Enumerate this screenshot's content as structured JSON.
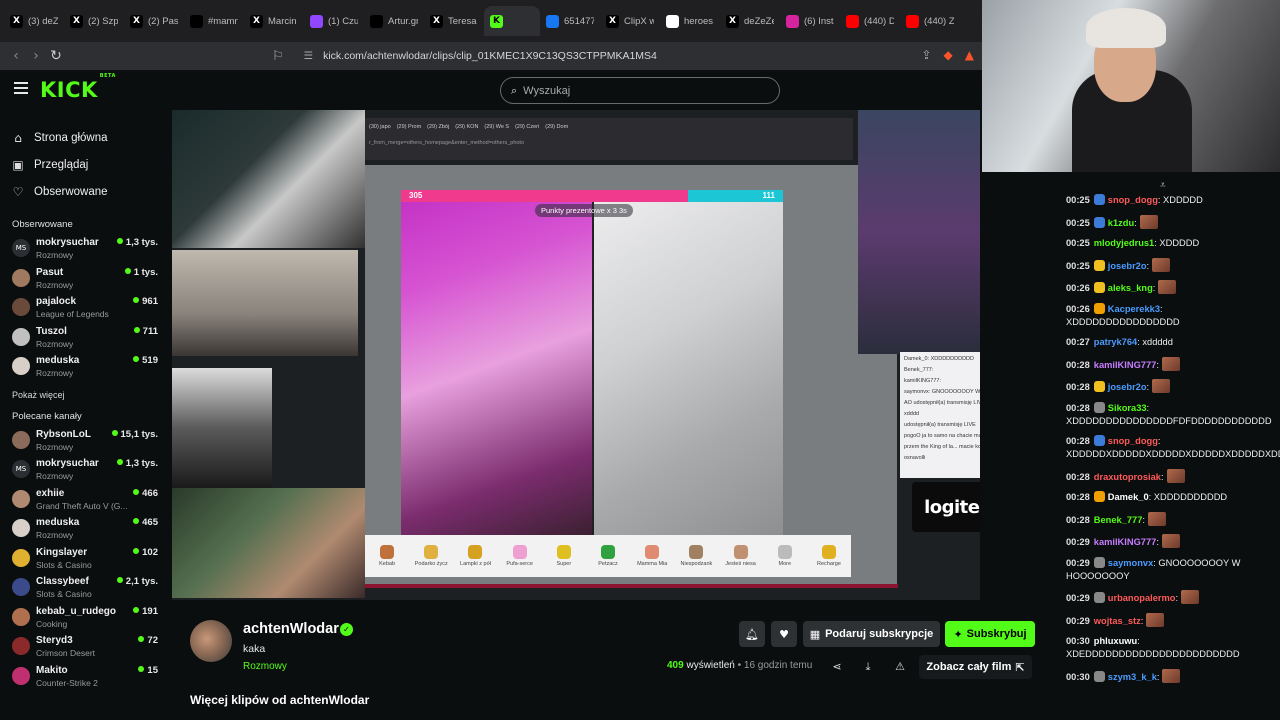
{
  "browser": {
    "tabs": [
      {
        "label": "(3) deZe",
        "icon": "x-icon",
        "color": "#000000"
      },
      {
        "label": "(2) Szpy",
        "icon": "x-icon",
        "color": "#000000"
      },
      {
        "label": "(2) Pasu",
        "icon": "x-icon",
        "color": "#000000"
      },
      {
        "label": "#mamn",
        "icon": "tiktok-icon",
        "color": "#000000"
      },
      {
        "label": "Marcin",
        "icon": "x-icon",
        "color": "#000000"
      },
      {
        "label": "(1) Czuj",
        "icon": "twitch-icon",
        "color": "#9146ff"
      },
      {
        "label": "Artur.gr",
        "icon": "tiktok-icon",
        "color": "#000000"
      },
      {
        "label": "Teresa",
        "icon": "x-icon",
        "color": "#000000"
      },
      {
        "label": "",
        "icon": "kick-icon",
        "color": "#53fc18",
        "active": true
      },
      {
        "label": "651477",
        "icon": "facebook-icon",
        "color": "#1877f2"
      },
      {
        "label": "ClipX w",
        "icon": "x-icon",
        "color": "#000000"
      },
      {
        "label": "heroes",
        "icon": "google-icon",
        "color": "#ffffff"
      },
      {
        "label": "deZeZe",
        "icon": "x-icon",
        "color": "#000000"
      },
      {
        "label": "(6) Insta",
        "icon": "instagram-icon",
        "color": "#d6249f"
      },
      {
        "label": "(440) D",
        "icon": "youtube-icon",
        "color": "#ff0000"
      },
      {
        "label": "(440) Z",
        "icon": "youtube-icon",
        "color": "#ff0000"
      }
    ],
    "url": "kick.com/achtenwlodar/clips/clip_01KMEC1X9C13QS3CTPPMKA1MS4"
  },
  "header": {
    "logo": "KICK",
    "logo_badge": "BETA",
    "search_placeholder": "Wyszukaj"
  },
  "sidebar": {
    "nav": [
      {
        "label": "Strona główna",
        "icon": "home-icon"
      },
      {
        "label": "Przeglądaj",
        "icon": "browse-icon"
      },
      {
        "label": "Obserwowane",
        "icon": "heart-icon"
      }
    ],
    "followed_heading": "Obserwowane",
    "followed": [
      {
        "name": "mokrysuchar",
        "category": "Rozmowy",
        "viewers": "1,3 tys.",
        "avatar": "MS",
        "color": "#2b2f33"
      },
      {
        "name": "Pasut",
        "category": "Rozmowy",
        "viewers": "1 tys.",
        "avatar": "",
        "color": "#a07a60"
      },
      {
        "name": "pajalock",
        "category": "League of Legends",
        "viewers": "961",
        "avatar": "",
        "color": "#6a4a3a"
      },
      {
        "name": "Tuszol",
        "category": "Rozmowy",
        "viewers": "711",
        "avatar": "",
        "color": "#c0c0c0"
      },
      {
        "name": "meduska",
        "category": "Rozmowy",
        "viewers": "519",
        "avatar": "",
        "color": "#d8d0c8"
      }
    ],
    "show_more": "Pokaż więcej",
    "recommended_heading": "Polecane kanały",
    "recommended": [
      {
        "name": "RybsonLoL",
        "category": "Rozmowy",
        "viewers": "15,1 tys.",
        "avatar": "",
        "color": "#8a6b5a"
      },
      {
        "name": "mokrysuchar",
        "category": "Rozmowy",
        "viewers": "1,3 tys.",
        "avatar": "MS",
        "color": "#2b2f33"
      },
      {
        "name": "exhiie",
        "category": "Grand Theft Auto V (G...",
        "viewers": "466",
        "avatar": "",
        "color": "#b08a70"
      },
      {
        "name": "meduska",
        "category": "Rozmowy",
        "viewers": "465",
        "avatar": "",
        "color": "#d8d0c8"
      },
      {
        "name": "Kingslayer",
        "category": "Slots & Casino",
        "viewers": "102",
        "avatar": "",
        "color": "#e0b030"
      },
      {
        "name": "Classybeef",
        "category": "Slots & Casino",
        "viewers": "2,1 tys.",
        "avatar": "",
        "color": "#3a4a8a"
      },
      {
        "name": "kebab_u_rudego",
        "category": "Cooking",
        "viewers": "191",
        "avatar": "",
        "color": "#b07050"
      },
      {
        "name": "Steryd3",
        "category": "Crimson Desert",
        "viewers": "72",
        "avatar": "",
        "color": "#8a2a2a"
      },
      {
        "name": "Makito",
        "category": "Counter-Strike 2",
        "viewers": "15",
        "avatar": "",
        "color": "#c03070"
      }
    ]
  },
  "video": {
    "pip_tabs": [
      "(30) japo",
      "(29) Prom",
      "(29) Zbój",
      "(29) KON",
      "(29) We S",
      "(29) Czeri",
      "(29) Dom"
    ],
    "pip_url": "r_from_merge=others_homepage&enter_method=others_photo",
    "score_left": "305",
    "score_right": "111",
    "score_fraction": 0.75,
    "battle_pill": "Punkty prezentowe x 3   3s",
    "gifts": [
      "Kebab",
      "Podarko życz",
      "Lampki z pół",
      "Pufa-serce",
      "Super",
      "Petzacz",
      "Mamma Mia",
      "Niespodzank",
      "Jesteś niesa",
      "More",
      "Recharge"
    ],
    "logitech": "logitech",
    "inner_chat": [
      "Damek_0: XDDDDDDDDDD",
      "Benek_777:",
      "kamilKING777:",
      "saymonvx: GNOOOOOOOY W HOOOOOOOY",
      "AO  udostępnił(a) transmisję LIVE",
      "xdddd",
      "udostępnił(a) transmisję LIVE",
      "pogoO  ja to samo na chacie mam",
      "przem the King of la... macie kontakt z matem palmerem",
      "osnavolli"
    ]
  },
  "chat": {
    "messages": [
      {
        "time": "00:25",
        "user": "snop_dogg",
        "text": ": XDDDDD",
        "color": "#ff5a5a",
        "badge": "#3d7bd9",
        "emote": false
      },
      {
        "time": "00:25",
        "user": "k1zdu",
        "text": ":",
        "color": "#53fc18",
        "badge": "#3d7bd9",
        "emote": true
      },
      {
        "time": "00:25",
        "user": "mlodyjedrus1",
        "text": ": XDDDDD",
        "color": "#53fc18",
        "badge": "",
        "emote": false
      },
      {
        "time": "00:25",
        "user": "josebr2o",
        "text": ":",
        "color": "#4a9cff",
        "badge": "#f0c020",
        "emote": true
      },
      {
        "time": "00:26",
        "user": "aleks_kng",
        "text": ":",
        "color": "#53fc18",
        "badge": "#f0c020",
        "emote": true
      },
      {
        "time": "00:26",
        "user": "Kacperekk3",
        "text": ": XDDDDDDDDDDDDDDDD",
        "color": "#4a9cff",
        "badge": "#f0a000",
        "emote": false
      },
      {
        "time": "00:27",
        "user": "patryk764",
        "text": ": xddddd",
        "color": "#4a9cff",
        "badge": "",
        "emote": false
      },
      {
        "time": "00:28",
        "user": "kamilKING777",
        "text": ":",
        "color": "#c77dff",
        "badge": "",
        "emote": true
      },
      {
        "time": "00:28",
        "user": "josebr2o",
        "text": ":",
        "color": "#4a9cff",
        "badge": "#f0c020",
        "emote": true
      },
      {
        "time": "00:28",
        "user": "Sikora33",
        "text": ": XDDDDDDDDDDDDDDDFDFDDDDDDDDDDDD",
        "color": "#53fc18",
        "badge": "#888888",
        "emote": false
      },
      {
        "time": "00:28",
        "user": "snop_dogg",
        "text": ": XDDDDDXDDDDDXDDDDDXDDDDDXDDDDDXDDDDDXDDDDDV",
        "color": "#ff5a5a",
        "badge": "#3d7bd9",
        "emote": false
      },
      {
        "time": "00:28",
        "user": "draxutoprosiak",
        "text": ":",
        "color": "#ff5a5a",
        "badge": "",
        "emote": true
      },
      {
        "time": "00:28",
        "user": "Damek_0",
        "text": ": XDDDDDDDDDD",
        "color": "#ffffff",
        "badge": "#f0a000",
        "emote": false
      },
      {
        "time": "00:28",
        "user": "Benek_777",
        "text": ":",
        "color": "#53fc18",
        "badge": "",
        "emote": true
      },
      {
        "time": "00:29",
        "user": "kamilKING777",
        "text": ":",
        "color": "#c77dff",
        "badge": "",
        "emote": true
      },
      {
        "time": "00:29",
        "user": "saymonvx",
        "text": ": GNOOOOOOOY W HOOOOOOOY",
        "color": "#4a9cff",
        "badge": "#888888",
        "emote": false
      },
      {
        "time": "00:29",
        "user": "urbanopalermo",
        "text": ":",
        "color": "#ff5a5a",
        "badge": "#888888",
        "emote": true
      },
      {
        "time": "00:29",
        "user": "wojtas_stz",
        "text": ":",
        "color": "#ff5a5a",
        "badge": "",
        "emote": true
      },
      {
        "time": "00:30",
        "user": "phluxuwu",
        "text": ": XDEDDDDDDDDDDDDDDDDDDDDDDD",
        "color": "#ffffff",
        "badge": "",
        "emote": false
      },
      {
        "time": "00:30",
        "user": "szym3_k_k",
        "text": ":",
        "color": "#4a9cff",
        "badge": "#888888",
        "emote": true
      }
    ]
  },
  "clip": {
    "channel": "achtenWlodar",
    "title": "kaka",
    "category": "Rozmowy",
    "gift_button": "Podaruj subskrypcje",
    "subscribe_button": "Subskrybuj",
    "views_count": "409",
    "views_label": "wyświetleń",
    "time_ago": "• 16 godzin temu",
    "full_film": "Zobacz cały film",
    "more_clips": "Więcej klipów od achtenWlodar"
  }
}
